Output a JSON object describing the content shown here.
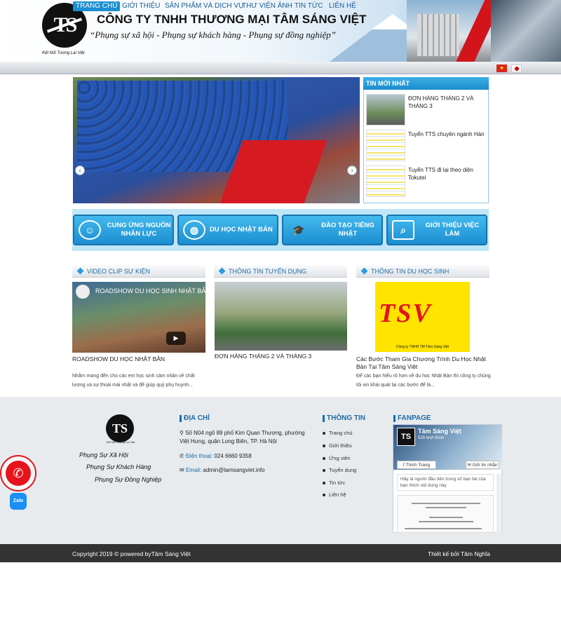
{
  "header": {
    "logo_text": "TS",
    "logo_tagline": "Kết Nối Tương Lai Việt",
    "company_name": "CÔNG TY TNHH THƯƠNG MẠI TÂM SÁNG VIỆT",
    "slogan": "“Phụng sự xã hội - Phụng sự khách hàng - Phụng sự đồng nghiệp”"
  },
  "nav": {
    "items": [
      {
        "label": "TRANG CHỦ",
        "active": true
      },
      {
        "label": "GIỚI THIỆU"
      },
      {
        "label": "SẢN PHẨM VÀ DỊCH VỤ"
      },
      {
        "label": "THƯ VIỆN ẢNH"
      },
      {
        "label": "TIN TỨC"
      },
      {
        "label": "LIÊN HỆ"
      }
    ],
    "flag_vn_symbol": "★"
  },
  "slider": {
    "prev_icon": "‹",
    "next_icon": "›"
  },
  "news": {
    "heading": "TIN MỚI NHẤT",
    "items": [
      {
        "title": "ĐƠN HÀNG THÁNG 2 VÀ THÁNG 3"
      },
      {
        "title": "Tuyển TTS chuyên ngành Hàn"
      },
      {
        "title": "Tuyển TTS đi lại theo diện Tokutei"
      }
    ]
  },
  "services": [
    {
      "label": "CUNG ỨNG NGUỒN NHÂN LỰC",
      "icon": "people-icon"
    },
    {
      "label": "DU HỌC NHẬT BẢN",
      "icon": "globe-icon"
    },
    {
      "label": "ĐÀO TẠO TIẾNG NHẬT",
      "icon": "graduation-cap-icon"
    },
    {
      "label": "GIỚI THIỆU VIỆC LÀM",
      "icon": "job-search-icon"
    }
  ],
  "columns": {
    "video": {
      "heading": "VIDEO CLIP SỰ KIỆN",
      "video_title": "ROADSHOW DU HỌC SINH NHẬT BẢN",
      "title": "ROADSHOW DU HỌC NHẬT BẢN",
      "text": "Nhằm mang đến cho các em học sinh cảm nhận về chất lượng và sự thoải mái nhất và để giúp quý phụ huynh..."
    },
    "recruit": {
      "heading": "THÔNG TIN TUYỂN DỤNG",
      "title": "ĐƠN HÀNG THÁNG 2 VÀ THÁNG 3"
    },
    "study": {
      "heading": "THÔNG TIN DU HỌC SINH",
      "logo_text": "TSV",
      "logo_caption": "Công ty TNHH TM Tâm Sáng Việt",
      "title": "Các Bước Tham Gia Chương Trình Du Học Nhật Bản Tại Tâm Sáng Việt",
      "text": "Để các bạn hiểu rõ hơn về du học Nhật Bản thì công ty chúng tôi xin khái quát lại các bước để là..."
    }
  },
  "footer": {
    "logo_text": "TS",
    "logo_tagline": "Kết Nối Tương Lai Việt",
    "slogans": [
      "Phụng Sự Xã Hội",
      "Phụng Sự Khách Hàng",
      "Phụng Sự Đồng Nghiệp"
    ],
    "address": {
      "heading": "ĐỊA CHỈ",
      "street": "Số N04 ngõ 89 phố Kim Quan Thượng, phường Việt Hưng, quận Long Biên, TP. Hà Nội",
      "phone_label": "Điện thoại:",
      "phone": "024 6660 9358",
      "email_label": "Email:",
      "email": "admin@tamsangviet.info"
    },
    "info": {
      "heading": "THÔNG TIN",
      "links": [
        "Trang chủ",
        "Giới thiệu",
        "Ứng viên",
        "Tuyển dụng",
        "Tin tức",
        "Liên hệ"
      ]
    },
    "fanpage": {
      "heading": "FANPAGE",
      "page_name": "Tâm Sáng Việt",
      "likes": "529 lượt thích",
      "like_label": "Thích Trang",
      "send_label": "Gửi tin nhắn",
      "post_text": "Hãy là người đầu tiên trong số bạn bè của bạn thích nội dung này"
    },
    "copyright": "Copyright 2019 © powered byTâm Sáng Việt",
    "designer": "Thiết kế bởi  Tâm Nghĩa"
  },
  "floating": {
    "call_icon": "✆",
    "zalo_label": "Zalo"
  }
}
